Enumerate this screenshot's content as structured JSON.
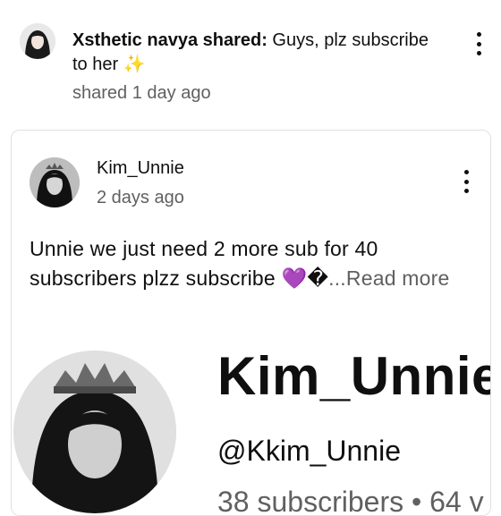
{
  "share": {
    "sharer_name": "Xsthetic navya shared:",
    "message": " Guys, plz subscribe to her ✨",
    "time": "shared 1 day ago"
  },
  "post": {
    "channel_name": "Kim_Unnie",
    "time": "2 days ago",
    "text": "Unnie we just need 2 more sub for 40 subscribers plzz subscribe 💜�",
    "read_more": "...Read more"
  },
  "image": {
    "channel_name": "Kim_Unnie",
    "handle": "@Kkim_Unnie",
    "subs_line": "38 subscribers • 64 v"
  },
  "icons": {
    "more": "more-vert-icon"
  }
}
